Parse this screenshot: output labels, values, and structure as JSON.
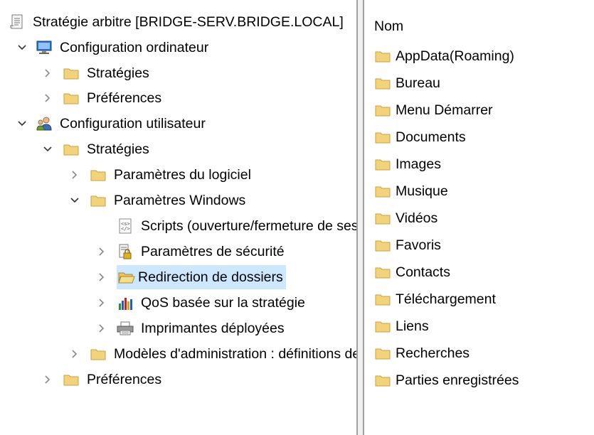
{
  "tree": {
    "root": {
      "label": "Stratégie arbitre [BRIDGE-SERV.BRIDGE.LOCAL]",
      "icon": "policy-document-icon"
    },
    "computer_config": {
      "label": "Configuration ordinateur",
      "icon": "computer-icon",
      "children": [
        {
          "label": "Stratégies",
          "icon": "folder-icon"
        },
        {
          "label": "Préférences",
          "icon": "folder-icon"
        }
      ]
    },
    "user_config": {
      "label": "Configuration utilisateur",
      "icon": "users-icon",
      "strategies": {
        "label": "Stratégies",
        "icon": "folder-icon",
        "software": {
          "label": "Paramètres du logiciel",
          "icon": "folder-icon"
        },
        "windows": {
          "label": "Paramètres Windows",
          "icon": "folder-icon",
          "children": [
            {
              "label": "Scripts (ouverture/fermeture de session)",
              "icon": "script-icon"
            },
            {
              "label": "Paramètres de sécurité",
              "icon": "security-lock-icon"
            },
            {
              "label": "Redirection de dossiers",
              "icon": "open-folder-icon",
              "selected": true
            },
            {
              "label": "QoS basée sur la stratégie",
              "icon": "bar-chart-icon"
            },
            {
              "label": "Imprimantes déployées",
              "icon": "printer-icon"
            }
          ]
        },
        "admin_templates": {
          "label": "Modèles d'administration : définitions de stratégies",
          "icon": "folder-icon"
        }
      },
      "preferences": {
        "label": "Préférences",
        "icon": "folder-icon"
      }
    }
  },
  "list": {
    "column_header": "Nom",
    "items": [
      "AppData(Roaming)",
      "Bureau",
      "Menu Démarrer",
      "Documents",
      "Images",
      "Musique",
      "Vidéos",
      "Favoris",
      "Contacts",
      "Téléchargement",
      "Liens",
      "Recherches",
      "Parties enregistrées"
    ]
  },
  "colors": {
    "selection": "#cce8ff",
    "folder": "#f2d27a",
    "folder_border": "#c9a33b"
  }
}
